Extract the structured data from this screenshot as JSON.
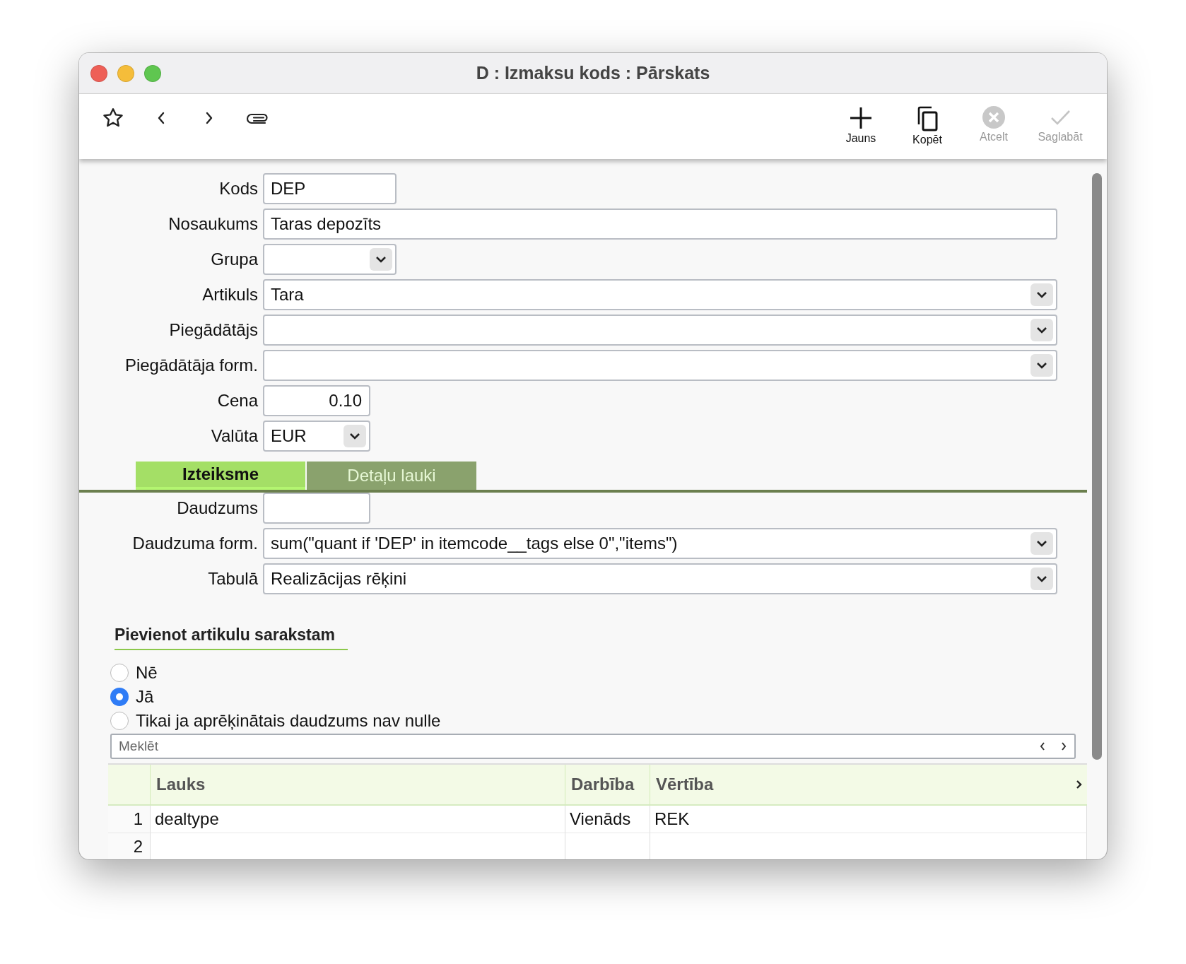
{
  "window": {
    "title": "D : Izmaksu kods : Pārskats"
  },
  "toolbar": {
    "left": [
      {
        "kind": "star"
      },
      {
        "kind": "back"
      },
      {
        "kind": "forward"
      },
      {
        "kind": "attach"
      }
    ],
    "right": [
      {
        "kind": "plus",
        "label": "Jauns",
        "disabled": false
      },
      {
        "kind": "copy",
        "label": "Kopēt",
        "disabled": false
      },
      {
        "kind": "cancel",
        "label": "Atcelt",
        "disabled": true
      },
      {
        "kind": "check",
        "label": "Saglabāt",
        "disabled": true
      }
    ]
  },
  "fields": [
    {
      "label": "Kods",
      "kind": "code",
      "value": "DEP"
    },
    {
      "label": "Nosaukums",
      "kind": "text",
      "value": "Taras depozīts"
    },
    {
      "label": "Grupa",
      "kind": "combo-short"
    },
    {
      "label": "Artikuls",
      "kind": "combo",
      "value": "Tara"
    },
    {
      "label": "Piegādātājs",
      "kind": "combo"
    },
    {
      "label": "Piegādātāja form.",
      "kind": "combo"
    },
    {
      "label": "Cena",
      "kind": "number",
      "value": "0.10"
    },
    {
      "label": "Valūta",
      "kind": "combo-small",
      "value": "EUR"
    }
  ],
  "tabs": [
    {
      "label": "Izteiksme",
      "selected": true
    },
    {
      "label": "Detaļu lauki",
      "selected": false
    }
  ],
  "expression_fields": [
    {
      "label": "Daudzums",
      "kind": "number"
    },
    {
      "label": "Daudzuma form.",
      "kind": "combo",
      "value": "sum(\"quant if 'DEP' in itemcode__tags else 0\",\"items\")"
    },
    {
      "label": "Tabulā",
      "kind": "combo",
      "value": "Realizācijas rēķini"
    }
  ],
  "section": {
    "title": "Pievienot artikulu sarakstam",
    "options": [
      {
        "label": "Nē",
        "selected": false
      },
      {
        "label": "Jā",
        "selected": true
      },
      {
        "label": "Tikai ja aprēķinātais daudzums nav nulle",
        "selected": false
      }
    ]
  },
  "search": {
    "placeholder": "Meklēt"
  },
  "table": {
    "columns": [
      "Lauks",
      "Darbība",
      "Vērtība"
    ],
    "rows": [
      {
        "number": "1",
        "cells": [
          "dealtype",
          "Vienāds",
          "REK"
        ]
      },
      {
        "number": "2",
        "cells": []
      }
    ]
  }
}
